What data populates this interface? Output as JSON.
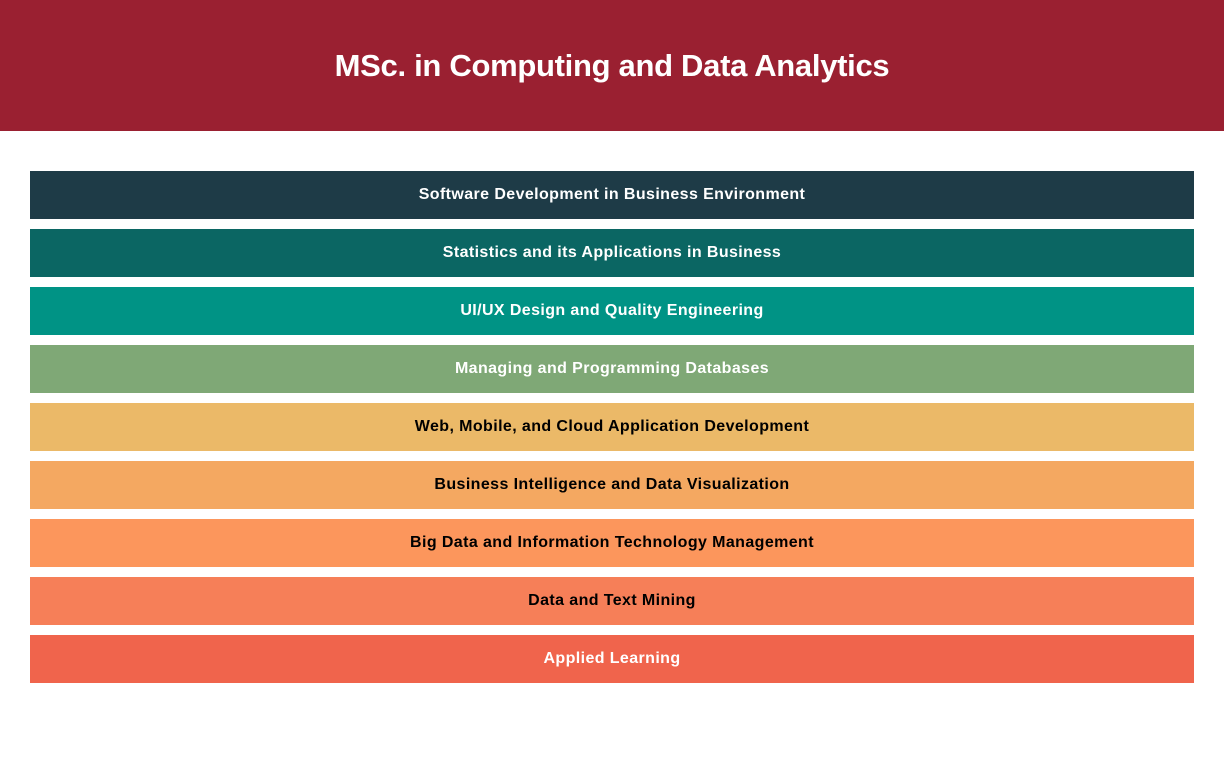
{
  "header": {
    "title": "MSc. in Computing and Data Analytics",
    "background": "#9a2031"
  },
  "courses": [
    {
      "label": "Software Development in Business Environment",
      "background": "#1e3b47",
      "text_color": "#ffffff"
    },
    {
      "label": "Statistics and its Applications in Business",
      "background": "#0b6663",
      "text_color": "#ffffff"
    },
    {
      "label": "UI/UX Design and Quality Engineering",
      "background": "#009385",
      "text_color": "#ffffff"
    },
    {
      "label": "Managing and Programming Databases",
      "background": "#7fa876",
      "text_color": "#ffffff"
    },
    {
      "label": "Web, Mobile, and Cloud Application Development",
      "background": "#ebb968",
      "text_color": "#000000"
    },
    {
      "label": "Business Intelligence and Data Visualization",
      "background": "#f4a861",
      "text_color": "#000000"
    },
    {
      "label": "Big Data and Information Technology Management",
      "background": "#fc965c",
      "text_color": "#000000"
    },
    {
      "label": "Data and Text Mining",
      "background": "#f67f58",
      "text_color": "#000000"
    },
    {
      "label": "Applied Learning",
      "background": "#f0644c",
      "text_color": "#ffffff"
    }
  ]
}
